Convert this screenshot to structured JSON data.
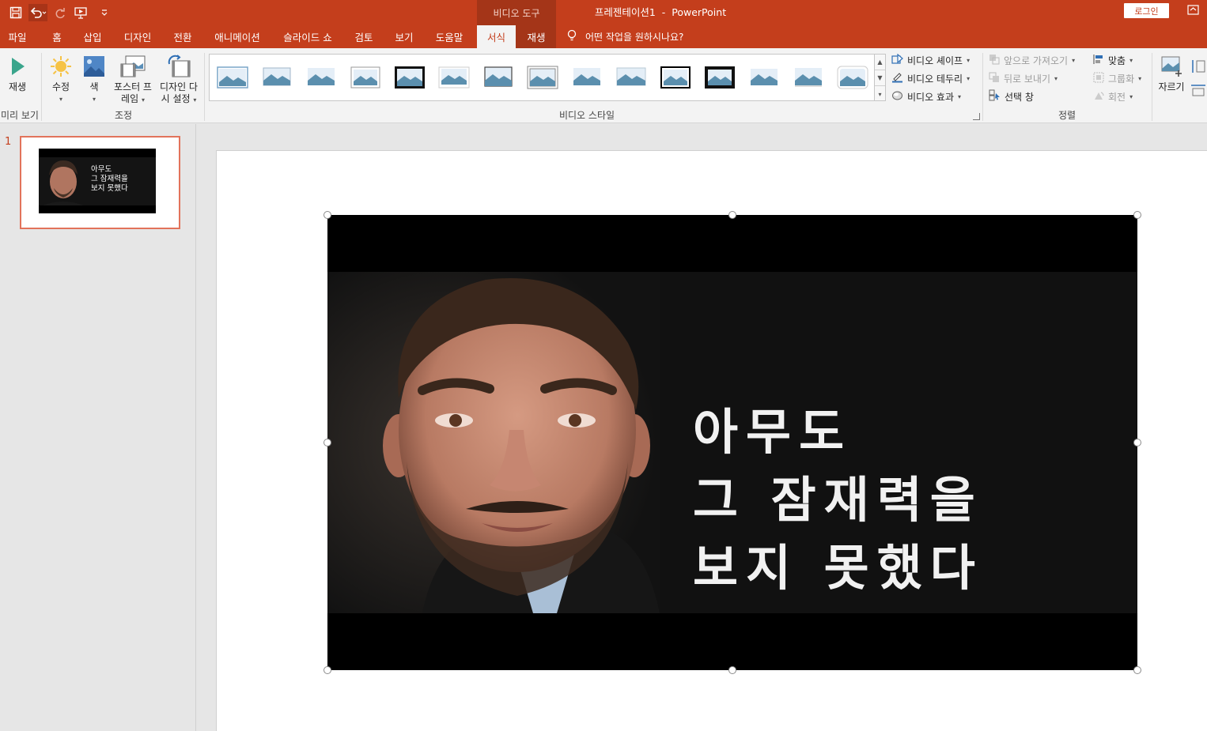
{
  "app": {
    "doc_title": "프레젠테이션1  -  PowerPoint",
    "context_tools": "비디오 도구",
    "login": "로그인"
  },
  "qat": {
    "icons": [
      "save-icon",
      "undo-icon",
      "redo-icon",
      "start-from-beginning-icon",
      "customize-qat-icon"
    ]
  },
  "tabs": [
    {
      "label": "파일"
    },
    {
      "label": "홈"
    },
    {
      "label": "삽입"
    },
    {
      "label": "디자인"
    },
    {
      "label": "전환"
    },
    {
      "label": "애니메이션"
    },
    {
      "label": "슬라이드 쇼"
    },
    {
      "label": "검토"
    },
    {
      "label": "보기"
    },
    {
      "label": "도움말"
    },
    {
      "label": "서식"
    },
    {
      "label": "재생"
    }
  ],
  "tellme": {
    "text": "어떤 작업을 원하시나요?"
  },
  "ribbon": {
    "preview_group": {
      "play_label": "재생",
      "group_label": "미리 보기"
    },
    "adjust_group": {
      "corrections_label": "수정",
      "color_label": "색",
      "poster_frame_label_1": "포스터 프",
      "poster_frame_label_2": "레임",
      "reset_design_label_1": "디자인 다",
      "reset_design_label_2": "시 설정",
      "group_label": "조정"
    },
    "styles_group": {
      "group_label": "비디오 스타일",
      "video_shape": "비디오 셰이프",
      "video_border": "비디오 테두리",
      "video_effects": "비디오 효과"
    },
    "arrange_group": {
      "bring_forward": "앞으로 가져오기",
      "send_backward": "뒤로 보내기",
      "selection_pane": "선택 창",
      "align": "맞춤",
      "group": "그룹화",
      "rotate": "회전",
      "group_label": "정렬"
    },
    "size_group": {
      "crop_label": "자르기"
    }
  },
  "slides_pane": {
    "slide_number": "1",
    "thumb_text": "아무도\n그 잠재력을\n보지 못했다"
  },
  "video": {
    "caption": "아무도\n그 잠재력을\n보지 못했다"
  }
}
